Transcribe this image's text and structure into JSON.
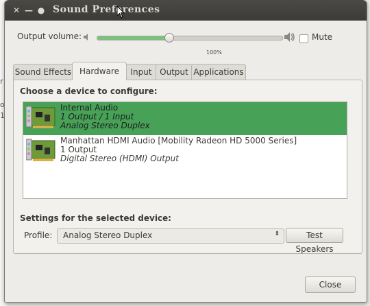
{
  "background_fragments": [
    "r",
    "o",
    "1"
  ],
  "window": {
    "title": "Sound Preferences",
    "close_icon": "close-icon",
    "minimize_icon": "minimize-icon",
    "maximize_icon": "maximize-icon"
  },
  "volume": {
    "label": "Output volume:",
    "percent_text": "100%",
    "level_fraction": 0.39,
    "mute_label": "Mute",
    "mute_checked": false
  },
  "tabs": [
    {
      "label": "Sound Effects",
      "active": false
    },
    {
      "label": "Hardware",
      "active": true
    },
    {
      "label": "Input",
      "active": false
    },
    {
      "label": "Output",
      "active": false
    },
    {
      "label": "Applications",
      "active": false
    }
  ],
  "hardware": {
    "choose_heading": "Choose a device to configure:",
    "devices": [
      {
        "name": "Internal Audio",
        "line2": "1 Output / 1 Input",
        "line3": "Analog Stereo Duplex",
        "selected": true,
        "icon": "sound-card-icon"
      },
      {
        "name": "Manhattan HDMI Audio [Mobility Radeon HD 5000 Series]",
        "line2": "1 Output",
        "line3": "Digital Stereo (HDMI) Output",
        "selected": false,
        "icon": "sound-card-icon"
      }
    ],
    "settings_heading": "Settings for the selected device:",
    "profile_label": "Profile:",
    "profile_value": "Analog Stereo Duplex",
    "test_button": "Test Speakers"
  },
  "close_button": "Close",
  "colors": {
    "titlebar": "#3c3b37",
    "selection": "#47a157",
    "slider_fill": "#7ac27c",
    "window_bg": "#edece8"
  }
}
